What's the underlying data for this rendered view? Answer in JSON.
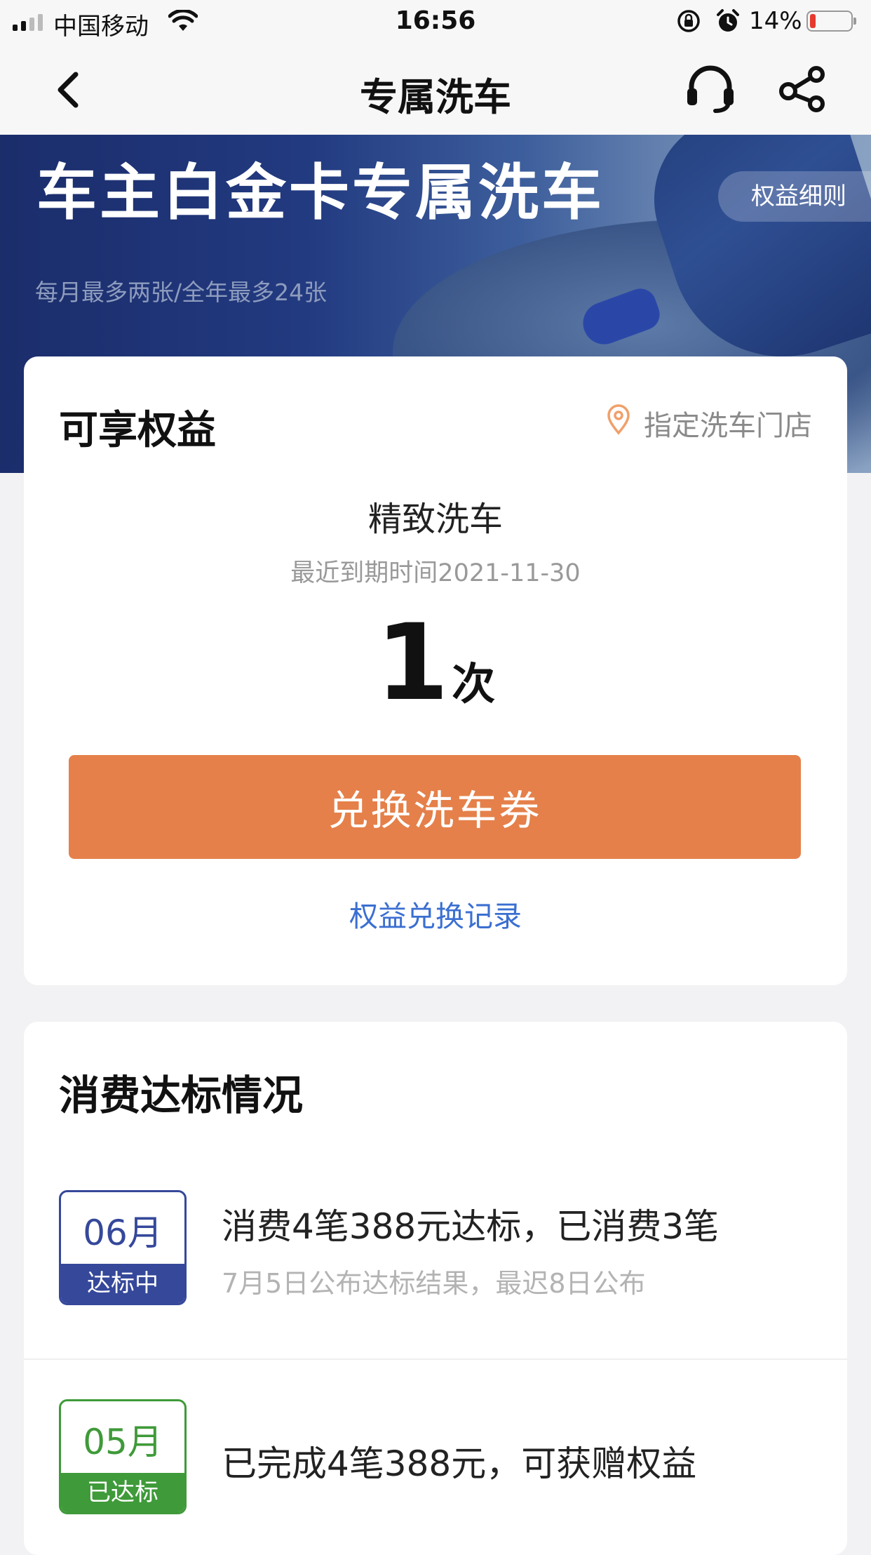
{
  "status_bar": {
    "carrier": "中国移动",
    "time": "16:56",
    "battery": "14%",
    "battery_level": 0.14
  },
  "nav": {
    "title": "专属洗车",
    "icons": [
      "back-icon",
      "headset-icon",
      "share-icon"
    ]
  },
  "banner": {
    "headline": "车主白金卡专属洗车",
    "subline": "每月最多两张/全年最多24张",
    "rules_label": "权益细则"
  },
  "benefit": {
    "title": "可享权益",
    "store_label": "指定洗车门店",
    "item_name": "精致洗车",
    "expiry": "最近到期时间2021-11-30",
    "count": "1",
    "unit": "次",
    "redeem_label": "兑换洗车券",
    "record_label": "权益兑换记录"
  },
  "spend": {
    "title": "消费达标情况",
    "rows": [
      {
        "month": "06月",
        "status": "达标中",
        "main": "消费4笔388元达标，已消费3笔",
        "sub": "7月5日公布达标结果，最迟8日公布"
      },
      {
        "month": "05月",
        "status": "已达标",
        "main": "已完成4笔388元，可获赠权益",
        "sub": ""
      }
    ]
  },
  "colors": {
    "accent_orange": "#e5804a",
    "link_blue": "#3b6fd1",
    "badge_in_progress": "#35489a",
    "badge_done": "#3f9a39",
    "banner_blue": "#1b2d6b"
  }
}
